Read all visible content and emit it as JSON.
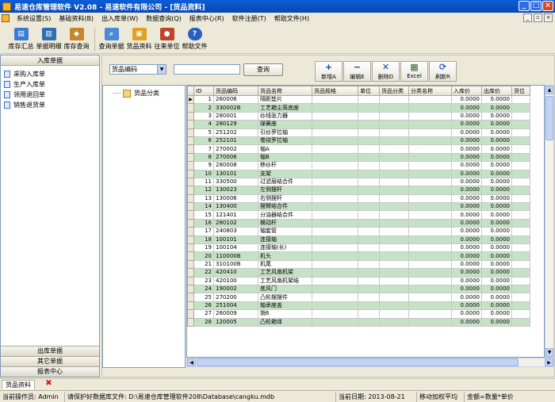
{
  "window": {
    "title": "易速仓库管理软件 V2.08 - 易速软件有限公司 - [货品资料]"
  },
  "menu": [
    "系统设置(S)",
    "基础资料(B)",
    "出入库单(W)",
    "数据查询(Q)",
    "报表中心(R)",
    "软件注册(T)",
    "帮助文件(H)"
  ],
  "toolbar": [
    {
      "label": "库存汇总",
      "icon": "warehouse-icon",
      "color": "#3a7bd5"
    },
    {
      "label": "单据明细",
      "icon": "chart-icon",
      "color": "#2f6db5"
    },
    {
      "label": "库存查询",
      "icon": "search-stock-icon",
      "color": "#c8862a"
    },
    {
      "label": "查询单据",
      "icon": "query-doc-icon",
      "color": "#4a8ad8"
    },
    {
      "label": "货品资料",
      "icon": "goods-icon",
      "color": "#e0a020"
    },
    {
      "label": "往来单位",
      "icon": "partners-icon",
      "color": "#c0442a"
    },
    {
      "label": "帮助文件",
      "icon": "help-icon",
      "color": "#2a5fc0"
    }
  ],
  "left_panel": {
    "header": "入库单据",
    "items": [
      "采购入库单",
      "生产入库单",
      "领用退回单",
      "销售退货单"
    ],
    "footers": [
      "出库单据",
      "其它单据",
      "报表中心"
    ]
  },
  "search": {
    "field": "货品编码",
    "value": "",
    "query_label": "查询"
  },
  "actions": [
    {
      "label": "新增A",
      "icon": "add-icon",
      "glyph": "+",
      "color": "#1a3fa8"
    },
    {
      "label": "编辑E",
      "icon": "edit-icon",
      "glyph": "−",
      "color": "#1a3fa8"
    },
    {
      "label": "删除D",
      "icon": "delete-icon",
      "glyph": "✕",
      "color": "#1a3fa8"
    },
    {
      "label": "Excel",
      "icon": "excel-icon",
      "glyph": "▦",
      "color": "#2a6a2a"
    },
    {
      "label": "刷新R",
      "icon": "refresh-icon",
      "glyph": "⟳",
      "color": "#2a5fc0"
    }
  ],
  "tree": {
    "root": "货品分类"
  },
  "grid": {
    "columns": [
      "ID",
      "货品编码",
      "货品名称",
      "货品规格",
      "单位",
      "货品分类",
      "分类名称",
      "入库价",
      "出库价",
      "货位"
    ],
    "rows": [
      [
        "1",
        "260006",
        "隔距垫片",
        "",
        "",
        "",
        "",
        "0.0000",
        "0.0000",
        ""
      ],
      [
        "2",
        "330002B",
        "工艺箱尘笼底座",
        "",
        "",
        "",
        "",
        "0.0000",
        "0.0000",
        ""
      ],
      [
        "3",
        "280001",
        "纱线张力器",
        "",
        "",
        "",
        "",
        "0.0000",
        "0.0000",
        ""
      ],
      [
        "4",
        "280129",
        "弹簧座",
        "",
        "",
        "",
        "",
        "0.0000",
        "0.0000",
        ""
      ],
      [
        "5",
        "251202",
        "引纱罗拉轴",
        "",
        "",
        "",
        "",
        "0.0000",
        "0.0000",
        ""
      ],
      [
        "6",
        "252101",
        "卷绕罗拉轴",
        "",
        "",
        "",
        "",
        "0.0000",
        "0.0000",
        ""
      ],
      [
        "7",
        "270002",
        "轴A",
        "",
        "",
        "",
        "",
        "0.0000",
        "0.0000",
        ""
      ],
      [
        "8",
        "270006",
        "轴B",
        "",
        "",
        "",
        "",
        "0.0000",
        "0.0000",
        ""
      ],
      [
        "9",
        "280008",
        "移纱杆",
        "",
        "",
        "",
        "",
        "0.0000",
        "0.0000",
        ""
      ],
      [
        "10",
        "130101",
        "支架",
        "",
        "",
        "",
        "",
        "0.0000",
        "0.0000",
        ""
      ],
      [
        "11",
        "330500",
        "过滤层结合件",
        "",
        "",
        "",
        "",
        "0.0000",
        "0.0000",
        ""
      ],
      [
        "12",
        "130023",
        "左侧摆杆",
        "",
        "",
        "",
        "",
        "0.0000",
        "0.0000",
        ""
      ],
      [
        "13",
        "130006",
        "右侧摆杆",
        "",
        "",
        "",
        "",
        "0.0000",
        "0.0000",
        ""
      ],
      [
        "14",
        "130400",
        "摆臂结合件",
        "",
        "",
        "",
        "",
        "0.0000",
        "0.0000",
        ""
      ],
      [
        "15",
        "121401",
        "分油器结合件",
        "",
        "",
        "",
        "",
        "0.0000",
        "0.0000",
        ""
      ],
      [
        "16",
        "280102",
        "横动杆",
        "",
        "",
        "",
        "",
        "0.0000",
        "0.0000",
        ""
      ],
      [
        "17",
        "240803",
        "轴套管",
        "",
        "",
        "",
        "",
        "0.0000",
        "0.0000",
        ""
      ],
      [
        "18",
        "100101",
        "连接轴",
        "",
        "",
        "",
        "",
        "0.0000",
        "0.0000",
        ""
      ],
      [
        "19",
        "100104",
        "连接轴(长)",
        "",
        "",
        "",
        "",
        "0.0000",
        "0.0000",
        ""
      ],
      [
        "20",
        "110000B",
        "机头",
        "",
        "",
        "",
        "",
        "0.0000",
        "0.0000",
        ""
      ],
      [
        "21",
        "310100B",
        "机尾",
        "",
        "",
        "",
        "",
        "0.0000",
        "0.0000",
        ""
      ],
      [
        "22",
        "420410",
        "工艺风扇机架",
        "",
        "",
        "",
        "",
        "0.0000",
        "0.0000",
        ""
      ],
      [
        "23",
        "420100",
        "工艺风扇机架结",
        "",
        "",
        "",
        "",
        "0.0000",
        "0.0000",
        ""
      ],
      [
        "24",
        "190002",
        "底风门",
        "",
        "",
        "",
        "",
        "0.0000",
        "0.0000",
        ""
      ],
      [
        "25",
        "270200",
        "凸轮摆摆件",
        "",
        "",
        "",
        "",
        "0.0000",
        "0.0000",
        ""
      ],
      [
        "26",
        "251004",
        "轴承座盖",
        "",
        "",
        "",
        "",
        "0.0000",
        "0.0000",
        ""
      ],
      [
        "27",
        "260009",
        "销6",
        "",
        "",
        "",
        "",
        "0.0000",
        "0.0000",
        ""
      ],
      [
        "28",
        "120005",
        "凸轮箱体",
        "",
        "",
        "",
        "",
        "0.0000",
        "0.0000",
        ""
      ]
    ]
  },
  "tabbar": {
    "tab": "货品资料"
  },
  "status": [
    "当前操作员: Admin",
    "请保护好数据库文件: D:\\易速仓库管理软件208\\Database\\cangku.mdb",
    "当前日期: 2013-08-21",
    "移动加权平均",
    "金额=数量*单价"
  ]
}
